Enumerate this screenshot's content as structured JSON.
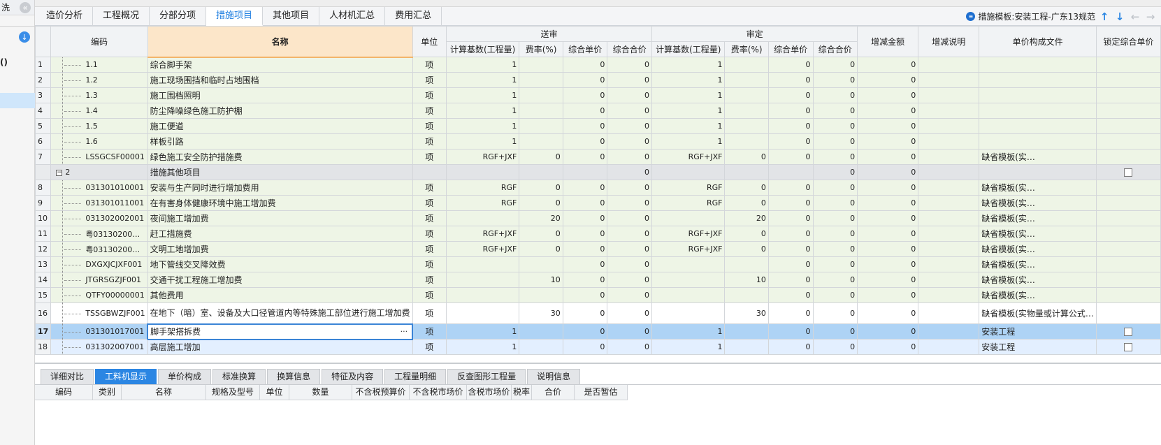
{
  "sidebar": {
    "top_text": "洗",
    "partial_text": "()"
  },
  "tabs": [
    {
      "label": "造价分析",
      "active": false
    },
    {
      "label": "工程概况",
      "active": false
    },
    {
      "label": "分部分项",
      "active": false
    },
    {
      "label": "措施项目",
      "active": true
    },
    {
      "label": "其他项目",
      "active": false
    },
    {
      "label": "人材机汇总",
      "active": false
    },
    {
      "label": "费用汇总",
      "active": false
    }
  ],
  "template": {
    "label": "措施模板:安装工程-广东13规范"
  },
  "columns": {
    "code": "编码",
    "name": "名称",
    "unit": "单位",
    "group_sent": "送审",
    "group_approved": "审定",
    "base": "计算基数(工程量)",
    "rate": "费率(%)",
    "unit_price": "综合单价",
    "total_price": "综合合价",
    "diff_amount": "增减金额",
    "diff_note": "增减说明",
    "price_file": "单价构成文件",
    "lock_price": "锁定综合单价"
  },
  "rows": [
    {
      "rn": "1",
      "code": "1.1",
      "name": "综合脚手架",
      "unit": "项",
      "s_base": "1",
      "s_rate": "",
      "s_up": "0",
      "s_tp": "0",
      "a_base": "1",
      "a_rate": "",
      "a_up": "0",
      "a_tp": "0",
      "diff": "0",
      "note": "",
      "file": "",
      "kind": "sub"
    },
    {
      "rn": "2",
      "code": "1.2",
      "name": "施工现场围挡和临时占地围档",
      "unit": "项",
      "s_base": "1",
      "s_rate": "",
      "s_up": "0",
      "s_tp": "0",
      "a_base": "1",
      "a_rate": "",
      "a_up": "0",
      "a_tp": "0",
      "diff": "0",
      "note": "",
      "file": "",
      "kind": "sub"
    },
    {
      "rn": "3",
      "code": "1.3",
      "name": "施工围档照明",
      "unit": "项",
      "s_base": "1",
      "s_rate": "",
      "s_up": "0",
      "s_tp": "0",
      "a_base": "1",
      "a_rate": "",
      "a_up": "0",
      "a_tp": "0",
      "diff": "0",
      "note": "",
      "file": "",
      "kind": "sub"
    },
    {
      "rn": "4",
      "code": "1.4",
      "name": "防尘降噪绿色施工防护棚",
      "unit": "项",
      "s_base": "1",
      "s_rate": "",
      "s_up": "0",
      "s_tp": "0",
      "a_base": "1",
      "a_rate": "",
      "a_up": "0",
      "a_tp": "0",
      "diff": "0",
      "note": "",
      "file": "",
      "kind": "sub"
    },
    {
      "rn": "5",
      "code": "1.5",
      "name": "施工便道",
      "unit": "项",
      "s_base": "1",
      "s_rate": "",
      "s_up": "0",
      "s_tp": "0",
      "a_base": "1",
      "a_rate": "",
      "a_up": "0",
      "a_tp": "0",
      "diff": "0",
      "note": "",
      "file": "",
      "kind": "sub"
    },
    {
      "rn": "6",
      "code": "1.6",
      "name": "样板引路",
      "unit": "项",
      "s_base": "1",
      "s_rate": "",
      "s_up": "0",
      "s_tp": "0",
      "a_base": "1",
      "a_rate": "",
      "a_up": "0",
      "a_tp": "0",
      "diff": "0",
      "note": "",
      "file": "",
      "kind": "sub"
    },
    {
      "rn": "7",
      "code": "LSSGCSF00001",
      "name": "绿色施工安全防护措施费",
      "unit": "项",
      "s_base": "RGF+JXF",
      "s_rate": "0",
      "s_up": "0",
      "s_tp": "0",
      "a_base": "RGF+JXF",
      "a_rate": "0",
      "a_up": "0",
      "a_tp": "0",
      "diff": "0",
      "note": "",
      "file": "缺省模板(实…",
      "kind": "sub"
    },
    {
      "rn": "",
      "code": "2",
      "name": "措施其他项目",
      "unit": "",
      "s_base": "",
      "s_rate": "",
      "s_up": "",
      "s_tp": "0",
      "a_base": "",
      "a_rate": "",
      "a_up": "",
      "a_tp": "0",
      "diff": "0",
      "note": "",
      "file": "",
      "kind": "group"
    },
    {
      "rn": "8",
      "code": "031301010001",
      "name": "安装与生产同时进行增加费用",
      "unit": "项",
      "s_base": "RGF",
      "s_rate": "0",
      "s_up": "0",
      "s_tp": "0",
      "a_base": "RGF",
      "a_rate": "0",
      "a_up": "0",
      "a_tp": "0",
      "diff": "0",
      "note": "",
      "file": "缺省模板(实…",
      "kind": "sub"
    },
    {
      "rn": "9",
      "code": "031301011001",
      "name": "在有害身体健康环境中施工增加费",
      "unit": "项",
      "s_base": "RGF",
      "s_rate": "0",
      "s_up": "0",
      "s_tp": "0",
      "a_base": "RGF",
      "a_rate": "0",
      "a_up": "0",
      "a_tp": "0",
      "diff": "0",
      "note": "",
      "file": "缺省模板(实…",
      "kind": "sub"
    },
    {
      "rn": "10",
      "code": "031302002001",
      "name": "夜间施工增加费",
      "unit": "项",
      "s_base": "",
      "s_rate": "20",
      "s_up": "0",
      "s_tp": "0",
      "a_base": "",
      "a_rate": "20",
      "a_up": "0",
      "a_tp": "0",
      "diff": "0",
      "note": "",
      "file": "缺省模板(实…",
      "kind": "sub"
    },
    {
      "rn": "11",
      "code": "粤03130200…",
      "name": "赶工措施费",
      "unit": "项",
      "s_base": "RGF+JXF",
      "s_rate": "0",
      "s_up": "0",
      "s_tp": "0",
      "a_base": "RGF+JXF",
      "a_rate": "0",
      "a_up": "0",
      "a_tp": "0",
      "diff": "0",
      "note": "",
      "file": "缺省模板(实…",
      "kind": "sub"
    },
    {
      "rn": "12",
      "code": "粤03130200…",
      "name": "文明工地增加费",
      "unit": "项",
      "s_base": "RGF+JXF",
      "s_rate": "0",
      "s_up": "0",
      "s_tp": "0",
      "a_base": "RGF+JXF",
      "a_rate": "0",
      "a_up": "0",
      "a_tp": "0",
      "diff": "0",
      "note": "",
      "file": "缺省模板(实…",
      "kind": "sub"
    },
    {
      "rn": "13",
      "code": "DXGXJCJXF001",
      "name": "地下管线交叉降效费",
      "unit": "项",
      "s_base": "",
      "s_rate": "",
      "s_up": "0",
      "s_tp": "0",
      "a_base": "",
      "a_rate": "",
      "a_up": "0",
      "a_tp": "0",
      "diff": "0",
      "note": "",
      "file": "缺省模板(实…",
      "kind": "sub"
    },
    {
      "rn": "14",
      "code": "JTGRSGZJF001",
      "name": "交通干扰工程施工增加费",
      "unit": "项",
      "s_base": "",
      "s_rate": "10",
      "s_up": "0",
      "s_tp": "0",
      "a_base": "",
      "a_rate": "10",
      "a_up": "0",
      "a_tp": "0",
      "diff": "0",
      "note": "",
      "file": "缺省模板(实…",
      "kind": "sub"
    },
    {
      "rn": "15",
      "code": "QTFY00000001",
      "name": "其他费用",
      "unit": "项",
      "s_base": "",
      "s_rate": "",
      "s_up": "0",
      "s_tp": "0",
      "a_base": "",
      "a_rate": "",
      "a_up": "0",
      "a_tp": "0",
      "diff": "0",
      "note": "",
      "file": "缺省模板(实…",
      "kind": "sub"
    },
    {
      "rn": "16",
      "code": "TSSGBWZJF001",
      "name": "在地下（暗）室、设备及大口径管道内等特殊施工部位进行施工增加费",
      "unit": "项",
      "s_base": "",
      "s_rate": "30",
      "s_up": "0",
      "s_tp": "0",
      "a_base": "",
      "a_rate": "30",
      "a_up": "0",
      "a_tp": "0",
      "diff": "0",
      "note": "",
      "file": "缺省模板(实物量或计算公式…",
      "kind": "tall"
    },
    {
      "rn": "17",
      "code": "031301017001",
      "name": "脚手架搭拆费",
      "unit": "项",
      "s_base": "1",
      "s_rate": "",
      "s_up": "0",
      "s_tp": "0",
      "a_base": "1",
      "a_rate": "",
      "a_up": "0",
      "a_tp": "0",
      "diff": "0",
      "note": "",
      "file": "安装工程",
      "kind": "sel"
    },
    {
      "rn": "18",
      "code": "031302007001",
      "name": "高层施工增加",
      "unit": "项",
      "s_base": "1",
      "s_rate": "",
      "s_up": "0",
      "s_tp": "0",
      "a_base": "1",
      "a_rate": "",
      "a_up": "0",
      "a_tp": "0",
      "diff": "0",
      "note": "",
      "file": "安装工程",
      "kind": "after"
    }
  ],
  "bottom_tabs": [
    {
      "label": "详细对比",
      "active": false
    },
    {
      "label": "工料机显示",
      "active": true
    },
    {
      "label": "单价构成",
      "active": false
    },
    {
      "label": "标准换算",
      "active": false
    },
    {
      "label": "换算信息",
      "active": false
    },
    {
      "label": "特征及内容",
      "active": false
    },
    {
      "label": "工程量明细",
      "active": false
    },
    {
      "label": "反查图形工程量",
      "active": false
    },
    {
      "label": "说明信息",
      "active": false
    }
  ],
  "bottom_columns": [
    "编码",
    "类别",
    "名称",
    "规格及型号",
    "单位",
    "数量",
    "不含税预算价",
    "不含税市场价",
    "含税市场价",
    "税率",
    "合价",
    "是否暂估"
  ],
  "ellipsis": "···"
}
